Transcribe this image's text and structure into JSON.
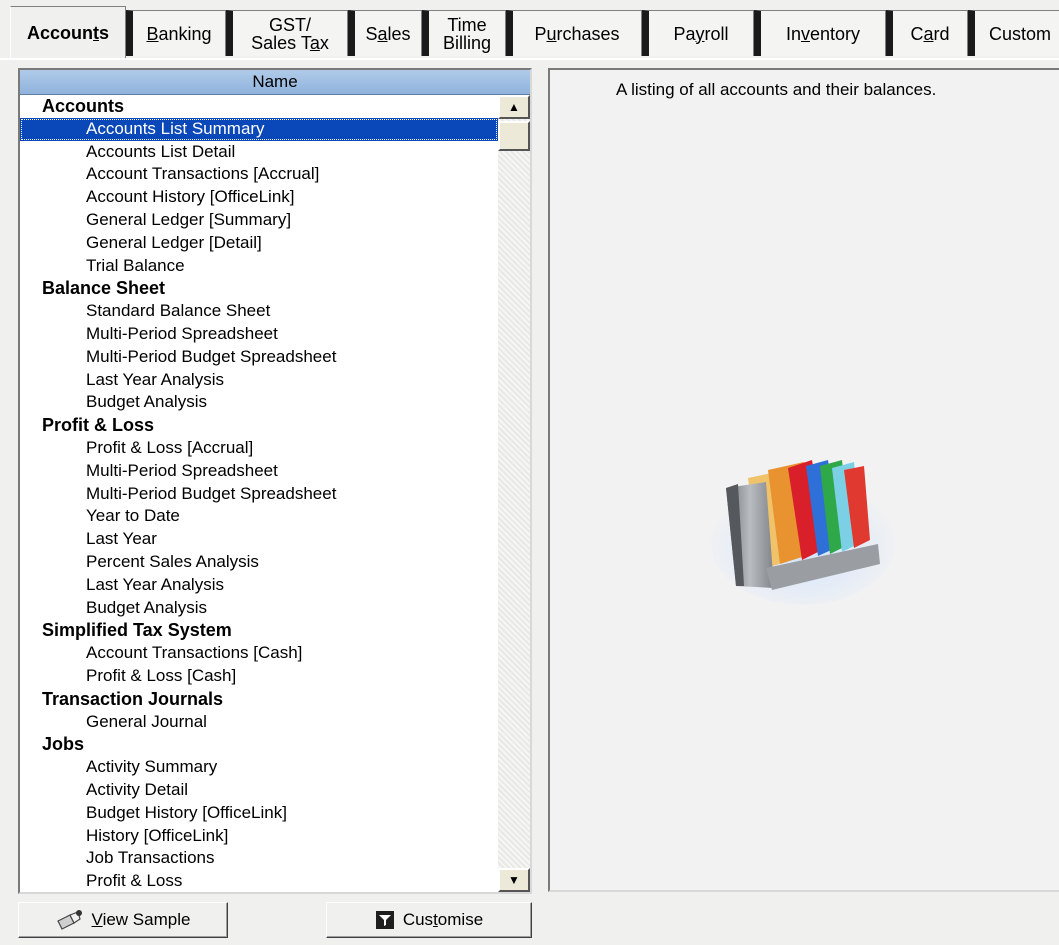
{
  "tabs": [
    {
      "label": "Accounts",
      "ul": 6,
      "active": true
    },
    {
      "label": "Banking",
      "ul": 0
    },
    {
      "label": "GST/\nSales Tax",
      "ul": 12
    },
    {
      "label": "Sales",
      "ul": 1
    },
    {
      "label": "Time\nBilling",
      "ul": -1
    },
    {
      "label": "Purchases",
      "ul": 1
    },
    {
      "label": "Payroll",
      "ul": 2
    },
    {
      "label": "Inventory",
      "ul": 2
    },
    {
      "label": "Card",
      "ul": 1
    },
    {
      "label": "Custom",
      "ul": -1
    }
  ],
  "list": {
    "column_header": "Name",
    "selected": "Accounts List Summary",
    "groups": [
      {
        "name": "Accounts",
        "items": [
          "Accounts List Summary",
          "Accounts List Detail",
          "Account Transactions [Accrual]",
          "Account History [OfficeLink]",
          "General Ledger [Summary]",
          "General Ledger [Detail]",
          "Trial Balance"
        ]
      },
      {
        "name": "Balance Sheet",
        "items": [
          "Standard Balance Sheet",
          "Multi-Period Spreadsheet",
          "Multi-Period Budget Spreadsheet",
          "Last Year Analysis",
          "Budget Analysis"
        ]
      },
      {
        "name": "Profit & Loss",
        "items": [
          "Profit & Loss [Accrual]",
          "Multi-Period Spreadsheet",
          "Multi-Period Budget Spreadsheet",
          "Year to Date",
          "Last Year",
          "Percent Sales Analysis",
          "Last Year Analysis",
          "Budget Analysis"
        ]
      },
      {
        "name": "Simplified Tax System",
        "items": [
          "Account Transactions [Cash]",
          "Profit & Loss [Cash]"
        ]
      },
      {
        "name": "Transaction Journals",
        "items": [
          "General Journal"
        ]
      },
      {
        "name": "Jobs",
        "items": [
          "Activity Summary",
          "Activity Detail",
          "Budget History [OfficeLink]",
          "History [OfficeLink]",
          "Job Transactions",
          "Profit & Loss"
        ]
      }
    ]
  },
  "description": "A listing of all accounts and their balances.",
  "buttons": {
    "view_sample": {
      "label": "View Sample",
      "ul": 0,
      "icon": "view-sample-icon"
    },
    "customise": {
      "label": "Customise",
      "ul": 3,
      "icon": "filter-icon"
    }
  }
}
